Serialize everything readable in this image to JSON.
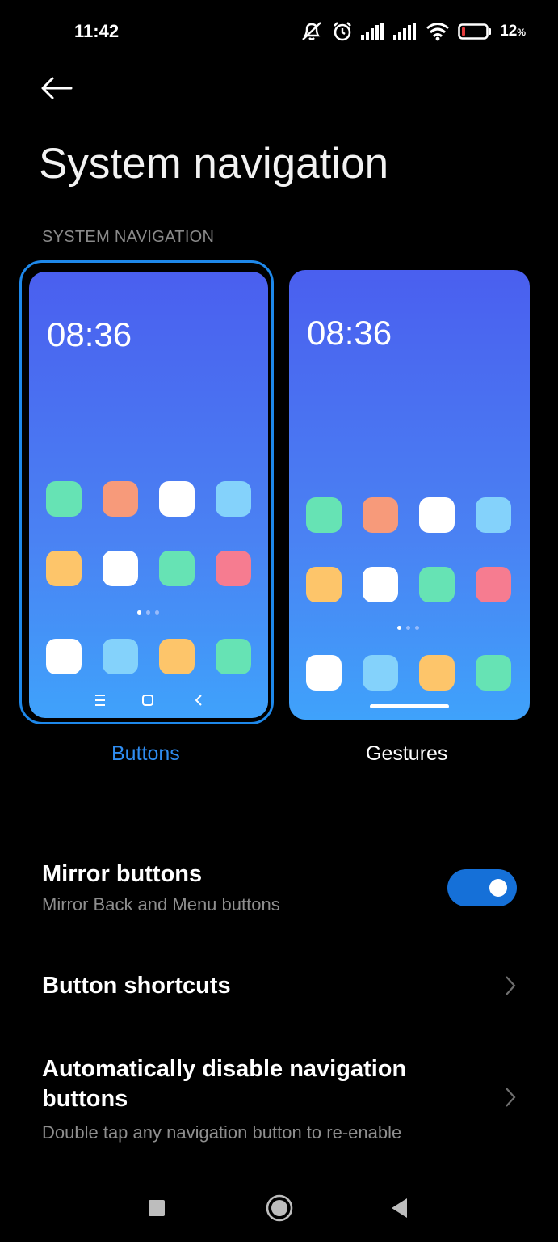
{
  "status_bar": {
    "time": "11:42",
    "battery_percent": "12",
    "battery_unit": "%",
    "icons": [
      "silent-alarm-icon",
      "alarm-icon",
      "signal-icon",
      "signal-icon",
      "wifi-icon",
      "battery-icon"
    ]
  },
  "header": {
    "back_icon": "back-arrow-icon",
    "title": "System navigation"
  },
  "section": {
    "label": "SYSTEM NAVIGATION"
  },
  "previews": {
    "buttons": {
      "time": "08:36",
      "label": "Buttons",
      "selected": true
    },
    "gestures": {
      "time": "08:36",
      "label": "Gestures",
      "selected": false
    }
  },
  "settings": {
    "mirror": {
      "title": "Mirror buttons",
      "subtitle": "Mirror Back and Menu buttons",
      "enabled": true
    },
    "shortcuts": {
      "title": "Button shortcuts"
    },
    "auto_disable": {
      "title": "Automatically disable navigation buttons",
      "subtitle": "Double tap any navigation button to re-enable"
    }
  },
  "colors": {
    "accent": "#2f8df2",
    "toggle_on": "#1570d8",
    "app_green": "#66e3b4",
    "app_orange": "#f79a7a",
    "app_white": "#ffffff",
    "app_lightblue": "#84d2fb",
    "app_yellow": "#fdc56a",
    "app_pink": "#f67c90"
  },
  "system_nav": [
    "recents-icon",
    "home-icon",
    "back-icon"
  ]
}
